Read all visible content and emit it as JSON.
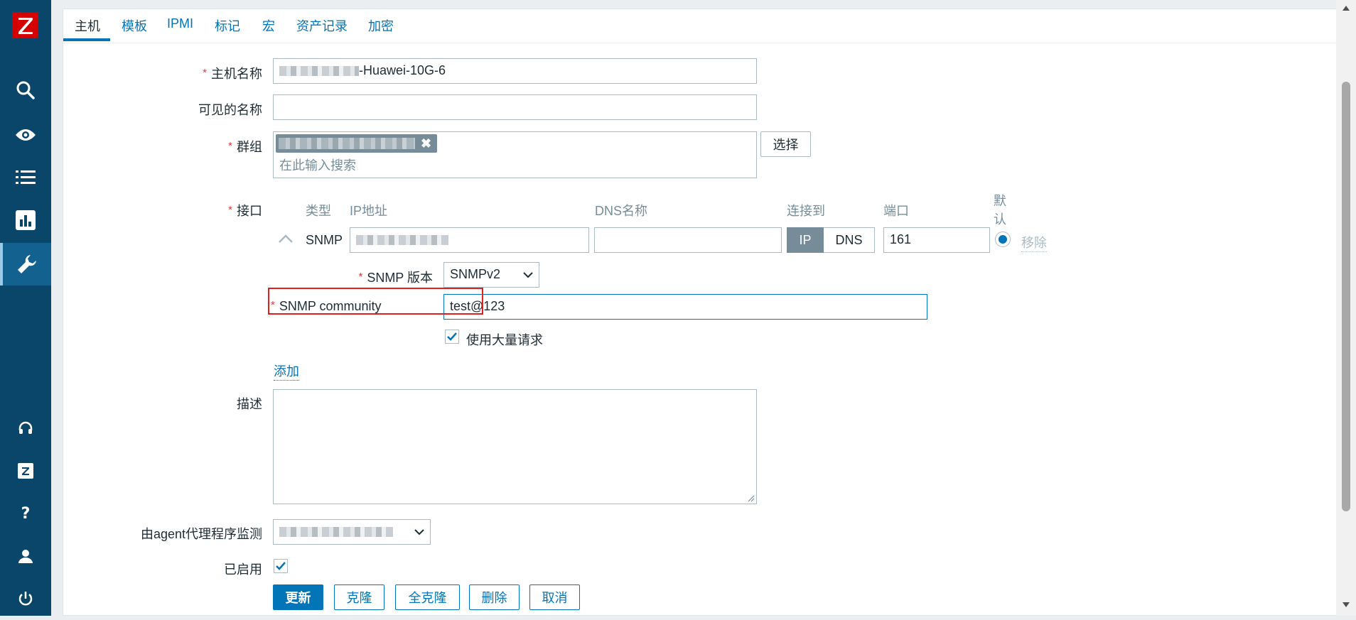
{
  "tabs": [
    "主机",
    "模板",
    "IPMI",
    "标记",
    "宏",
    "资产记录",
    "加密"
  ],
  "form": {
    "hostname_label": "主机名称",
    "hostname_value": "-Huawei-10G-6",
    "visible_name_label": "可见的名称",
    "visible_name_value": "",
    "groups_label": "群组",
    "groups_placeholder": "在此输入搜索",
    "select_button": "选择",
    "interfaces_label": "接口",
    "iface_headers": {
      "type": "类型",
      "ip": "IP地址",
      "dns": "DNS名称",
      "connect": "连接到",
      "port": "端口",
      "default": "默认"
    },
    "iface": {
      "type": "SNMP",
      "ip_toggle": "IP",
      "dns_toggle": "DNS",
      "port": "161",
      "remove": "移除"
    },
    "snmp_version_label": "SNMP 版本",
    "snmp_version_value": "SNMPv2",
    "snmp_community_label": "SNMP community",
    "snmp_community_value": "test@123",
    "bulk_label": "使用大量请求",
    "add_link": "添加",
    "description_label": "描述",
    "proxy_label": "由agent代理程序监测",
    "enabled_label": "已启用"
  },
  "buttons": {
    "update": "更新",
    "clone": "克隆",
    "full_clone": "全克隆",
    "delete": "删除",
    "cancel": "取消"
  },
  "colors": {
    "sidebar": "#0a466a",
    "accent": "#0275b8",
    "highlight_box": "#e02020"
  }
}
